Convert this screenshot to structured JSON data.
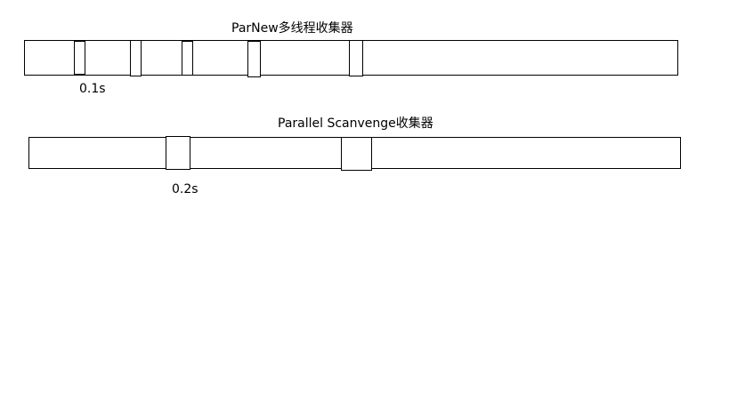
{
  "diagrams": [
    {
      "title": "ParNew多线程收集器",
      "pause_label": "0.1s"
    },
    {
      "title": "Parallel Scanvenge收集器",
      "pause_label": "0.2s"
    }
  ]
}
